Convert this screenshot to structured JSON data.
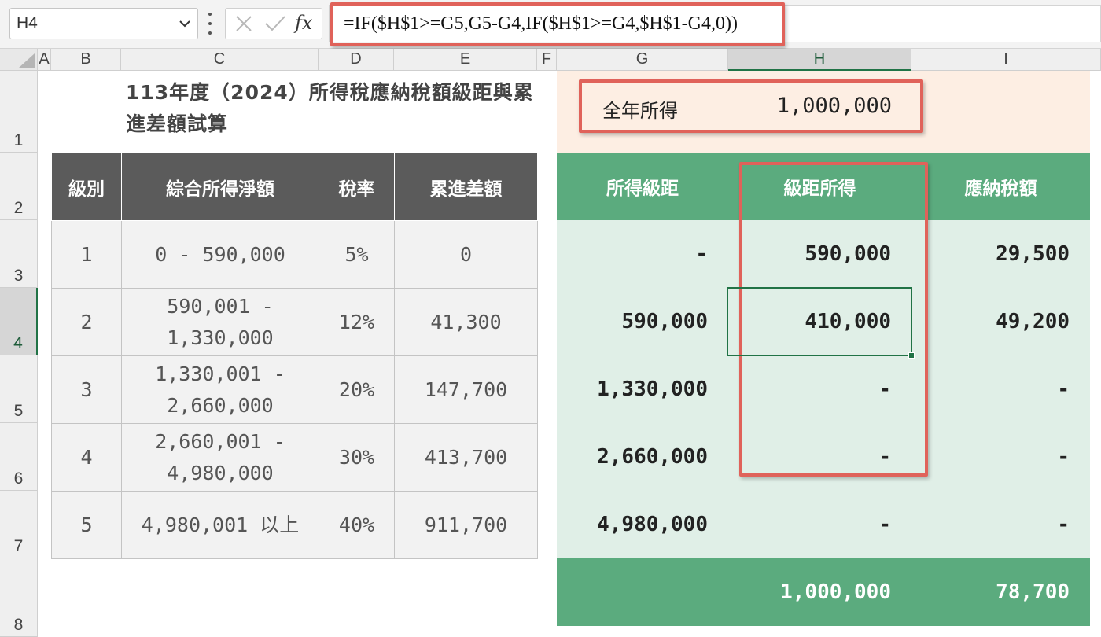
{
  "formula_bar": {
    "name_box": "H4",
    "fx_label": "fx",
    "formula": "=IF($H$1>=G5,G5-G4,IF($H$1>=G4,$H$1-G4,0))"
  },
  "columns": [
    "A",
    "B",
    "C",
    "D",
    "E",
    "F",
    "G",
    "H",
    "I"
  ],
  "rows": [
    "1",
    "2",
    "3",
    "4",
    "5",
    "6",
    "7",
    "8"
  ],
  "title": "113年度（2024）所得稅應納稅額級距與累進差額試算",
  "bracket_table": {
    "headers": [
      "級別",
      "綜合所得淨額",
      "稅率",
      "累進差額"
    ],
    "rows": [
      {
        "level": "1",
        "range": "0 - 590,000",
        "rate": "5%",
        "diff": "0"
      },
      {
        "level": "2",
        "range": "590,001 - 1,330,000",
        "rate": "12%",
        "diff": "41,300"
      },
      {
        "level": "3",
        "range": "1,330,001 - 2,660,000",
        "rate": "20%",
        "diff": "147,700"
      },
      {
        "level": "4",
        "range": "2,660,001 - 4,980,000",
        "rate": "30%",
        "diff": "413,700"
      },
      {
        "level": "5",
        "range": "4,980,001 以上",
        "rate": "40%",
        "diff": "911,700"
      }
    ]
  },
  "income": {
    "label": "全年所得",
    "value": "1,000,000"
  },
  "calc_table": {
    "headers": [
      "所得級距",
      "級距所得",
      "應納稅額"
    ],
    "rows": [
      {
        "bracket": "-",
        "bracket_income": "590,000",
        "tax": "29,500"
      },
      {
        "bracket": "590,000",
        "bracket_income": "410,000",
        "tax": "49,200"
      },
      {
        "bracket": "1,330,000",
        "bracket_income": "-",
        "tax": "-"
      },
      {
        "bracket": "2,660,000",
        "bracket_income": "-",
        "tax": "-"
      },
      {
        "bracket": "4,980,000",
        "bracket_income": "-",
        "tax": "-"
      }
    ],
    "total": {
      "bracket": "",
      "bracket_income": "1,000,000",
      "tax": "78,700"
    }
  },
  "colors": {
    "header_dark": "#5b5b5b",
    "green": "#5bab7e",
    "green_light": "#e0efe7",
    "peach": "#fdeee3",
    "highlight_red": "#e0625a",
    "excel_green": "#217346"
  }
}
